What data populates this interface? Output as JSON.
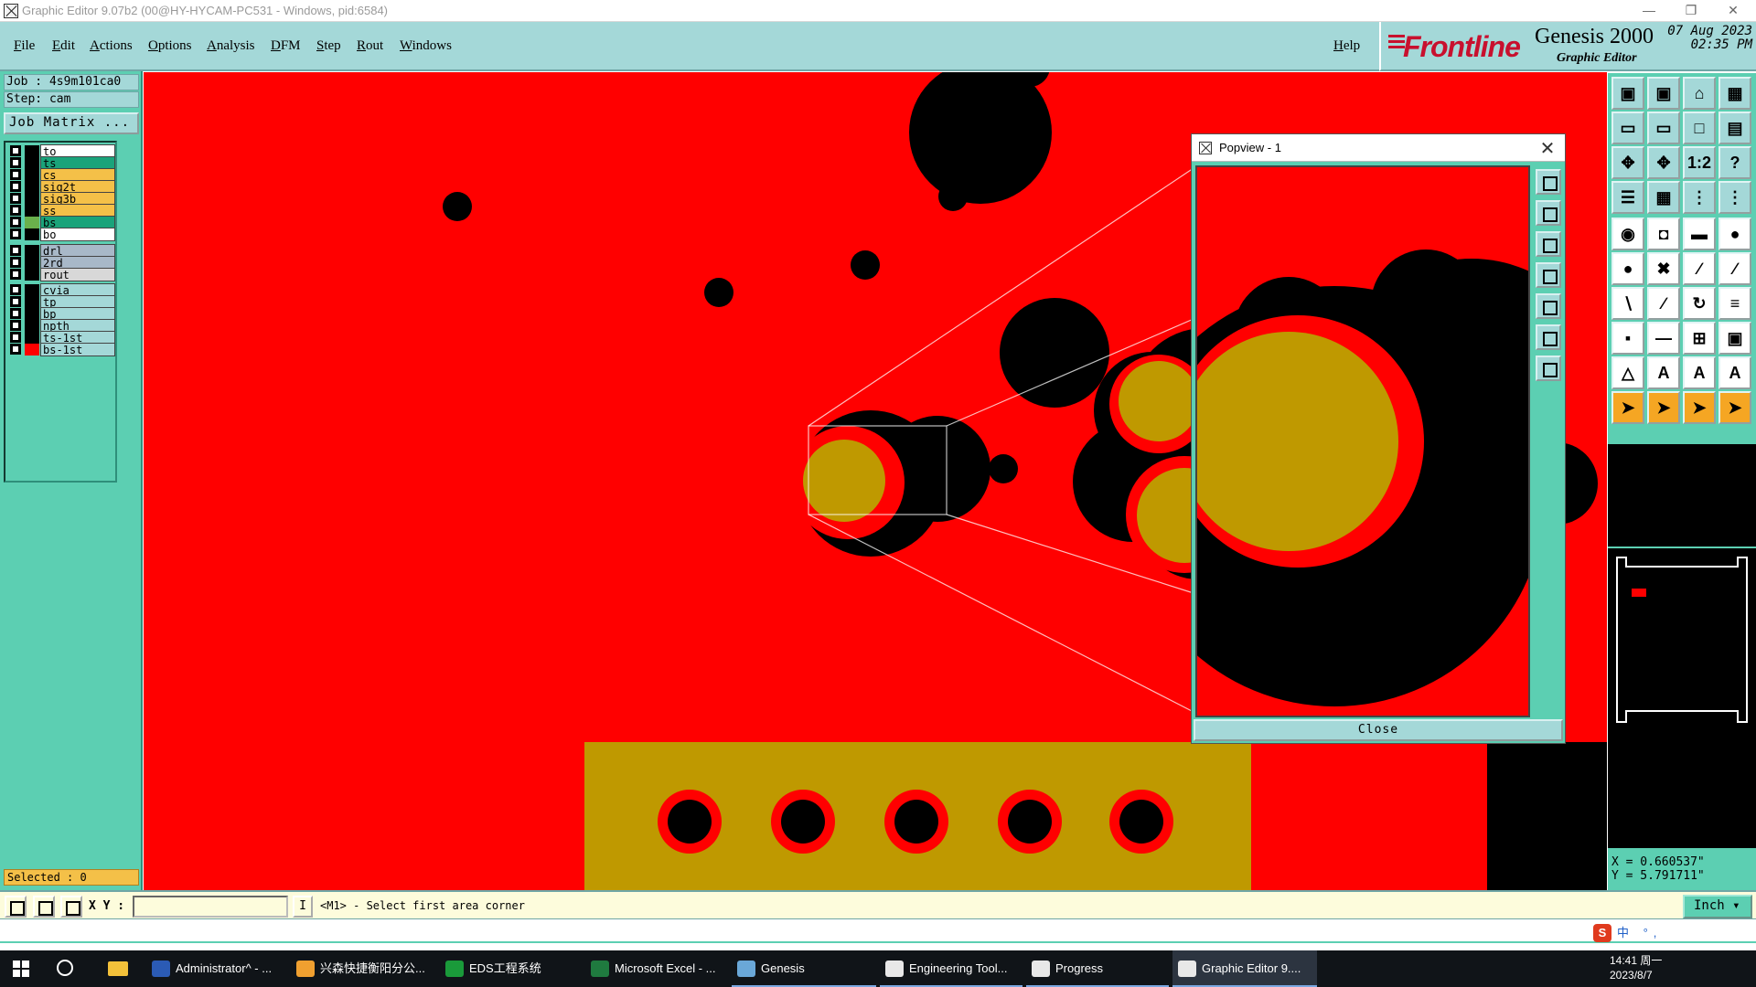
{
  "window": {
    "title": "Graphic Editor 9.07b2 (00@HY-HYCAM-PC531 - Windows, pid:6584)"
  },
  "menu": {
    "items": [
      "File",
      "Edit",
      "Actions",
      "Options",
      "Analysis",
      "DFM",
      "Step",
      "Rout",
      "Windows"
    ],
    "help": "Help"
  },
  "brand": {
    "logo": "Frontline",
    "product": "Genesis 2000",
    "subtitle": "Graphic Editor",
    "date": "07  Aug  2023",
    "time": "02:35  PM"
  },
  "job": {
    "job_line": "Job  : 4s9m101ca0",
    "step_line": "Step: cam",
    "matrix_button": "Job Matrix ...",
    "selected": "Selected : 0"
  },
  "layers": [
    {
      "name": "to",
      "color": "#ffffff",
      "swatch": "#000000"
    },
    {
      "name": "ts",
      "color": "#1aa37a",
      "swatch": "#000000"
    },
    {
      "name": "cs",
      "color": "#f4c048",
      "swatch": "#000000"
    },
    {
      "name": "sig2t",
      "color": "#f4c048",
      "swatch": "#000000"
    },
    {
      "name": "sig3b",
      "color": "#f4c048",
      "swatch": "#000000"
    },
    {
      "name": "ss",
      "color": "#f4c048",
      "swatch": "#000000"
    },
    {
      "name": "bs",
      "color": "#1aa37a",
      "swatch": "#6ab04c"
    },
    {
      "name": "bo",
      "color": "#ffffff",
      "swatch": "#000000"
    },
    {
      "name": "drl",
      "color": "#a8b8c8",
      "swatch": "#000000"
    },
    {
      "name": "2rd",
      "color": "#a8b8c8",
      "swatch": "#000000"
    },
    {
      "name": "rout",
      "color": "#d8d8d8",
      "swatch": "#000000"
    },
    {
      "name": "cvia",
      "color": "#a4d8d8",
      "swatch": "#000000"
    },
    {
      "name": "tp",
      "color": "#a4d8d8",
      "swatch": "#000000"
    },
    {
      "name": "bp",
      "color": "#a4d8d8",
      "swatch": "#000000"
    },
    {
      "name": "npth",
      "color": "#a4d8d8",
      "swatch": "#000000"
    },
    {
      "name": "ts-1st",
      "color": "#a4d8d8",
      "swatch": "#000000"
    },
    {
      "name": "bs-1st",
      "color": "#a4d8d8",
      "swatch": "#ff0000"
    }
  ],
  "popview": {
    "title": "Popview - 1",
    "close_label": "Close"
  },
  "command": {
    "xy_label": "X Y :",
    "xy_value": "",
    "cursor_label": "I",
    "prompt": "<M1> - Select first area corner",
    "units": "Inch"
  },
  "coords": {
    "x": "X  = 0.660537\"",
    "y": "Y  = 5.791711\""
  },
  "colors": {
    "canvas_bg": "#ff0000",
    "copper": "#bf9900",
    "hole": "#000000",
    "panel": "#5ccfb2",
    "menubar": "#a4d8d8"
  },
  "taskbar": {
    "items": [
      {
        "label": "Administrator^ - ...",
        "icon_color": "#2b5bb5"
      },
      {
        "label": "兴森快捷衡阳分公...",
        "icon_color": "#f0a030"
      },
      {
        "label": "EDS工程系统",
        "icon_color": "#1a9a3a"
      },
      {
        "label": "Microsoft Excel - ...",
        "icon_color": "#1f7a3f"
      },
      {
        "label": "Genesis",
        "icon_color": "#6aa8d8"
      },
      {
        "label": "Engineering Tool...",
        "icon_color": "#e8e8e8"
      },
      {
        "label": "Progress",
        "icon_color": "#e8e8e8"
      },
      {
        "label": "Graphic Editor 9....",
        "icon_color": "#e8e8e8"
      }
    ],
    "ime": "中 °, ",
    "time": "14:41 周一",
    "date": "2023/8/7"
  }
}
